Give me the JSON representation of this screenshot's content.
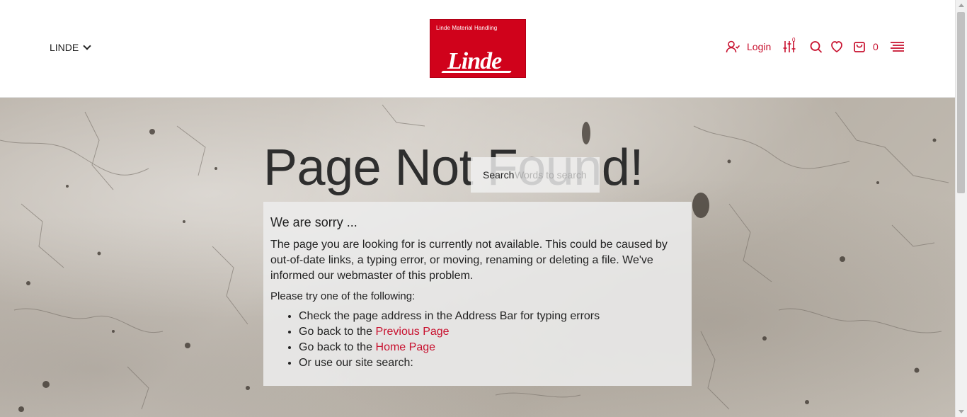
{
  "header": {
    "brand_selector": "LINDE",
    "logo": {
      "tagline": "Linde Material Handling",
      "wordmark": "Linde",
      "color": "#d0021b"
    },
    "login_label": "Login",
    "compare_count": "0",
    "cart_count": "0",
    "accent_color": "#c8102e",
    "icons": [
      "user-icon",
      "compare-sliders-icon",
      "search-icon",
      "heart-icon",
      "shopping-bag-icon",
      "menu-icon"
    ]
  },
  "hero": {
    "headline": "Page Not Found!",
    "search": {
      "label": "Search",
      "placeholder": "Words to search"
    }
  },
  "message": {
    "sorry": "We are sorry ...",
    "paragraph": "The page you are looking for is currently not available. This could be caused by out-of-date links, a typing error, or moving, renaming or deleting a file. We've informed our webmaster of this problem.",
    "try_label": "Please try one of the following:",
    "items": [
      {
        "text": "Check the page address in the Address Bar for typing errors"
      },
      {
        "text": "Go back to the ",
        "link": "Previous Page"
      },
      {
        "text": "Go back to the ",
        "link": "Home Page"
      },
      {
        "text": "Or use our site search:"
      }
    ]
  }
}
